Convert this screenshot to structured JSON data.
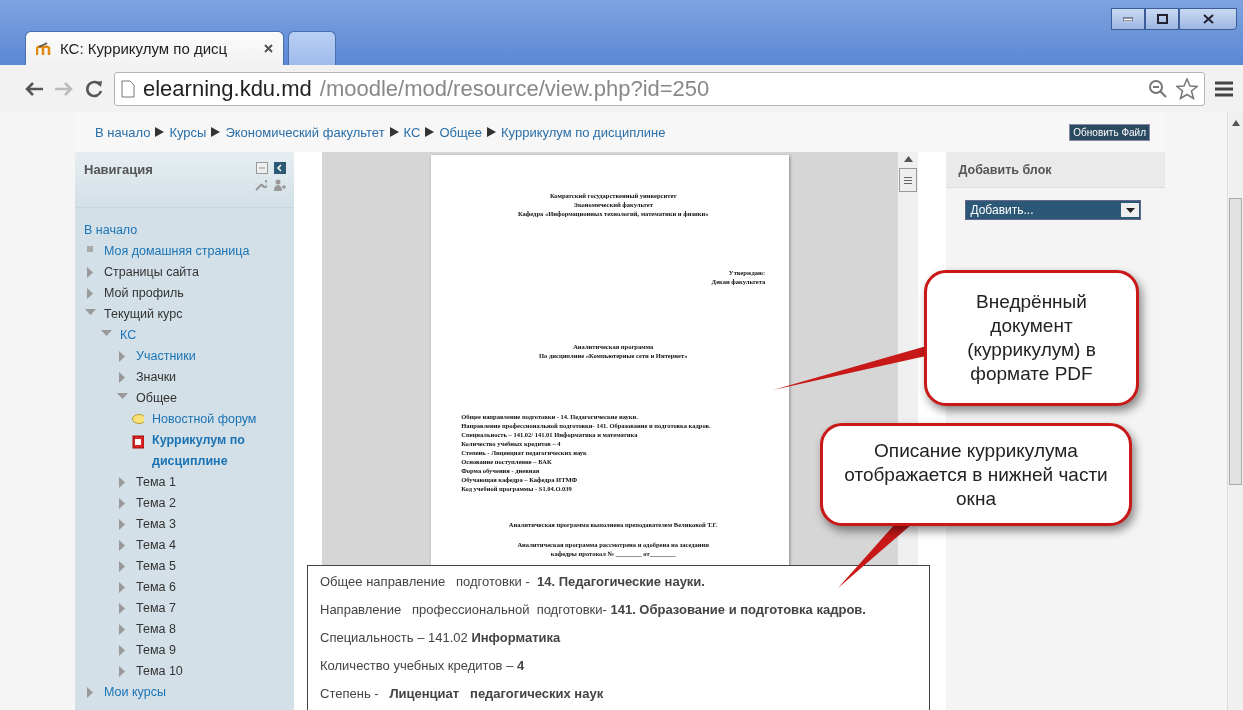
{
  "tabs": [
    {
      "title": "КС: Куррикулум по дисц",
      "selected": true,
      "kind": "page"
    },
    {
      "selected": false,
      "kind": "new"
    }
  ],
  "address": {
    "host": "elearning.kdu.md",
    "path": "/moodle/mod/resource/view.php?id=250"
  },
  "breadcrumb": [
    "В начало",
    "Курсы",
    "Экономический факультет",
    "КС",
    "Общее",
    "Куррикулум по дисциплине"
  ],
  "update_button": "Обновить Файл",
  "navigation": {
    "title": "Навигация",
    "items": [
      {
        "label": "В начало",
        "kind": "root",
        "link": true,
        "selected": false
      },
      {
        "label": "Моя домашняя страница",
        "kind": "leaf",
        "link": true,
        "selected": false
      },
      {
        "label": "Страницы сайта",
        "kind": "branch",
        "expanded": false,
        "link": false,
        "selected": false
      },
      {
        "label": "Мой профиль",
        "kind": "branch",
        "expanded": false,
        "link": false,
        "selected": false
      },
      {
        "label": "Текущий курс",
        "kind": "branch",
        "expanded": true,
        "link": false,
        "selected": false,
        "children": [
          {
            "label": "КС",
            "kind": "branch",
            "expanded": true,
            "link": true,
            "selected": false,
            "children": [
              {
                "label": "Участники",
                "kind": "branch",
                "expanded": false,
                "link": true,
                "selected": false
              },
              {
                "label": "Значки",
                "kind": "branch",
                "expanded": false,
                "link": false,
                "selected": false
              },
              {
                "label": "Общее",
                "kind": "branch",
                "expanded": true,
                "link": false,
                "selected": false,
                "children": [
                  {
                    "label": "Новостной форум",
                    "kind": "forum",
                    "link": true,
                    "selected": false
                  },
                  {
                    "label": "Куррикулум по дисциплине",
                    "kind": "pdf",
                    "link": true,
                    "selected": true
                  }
                ]
              },
              {
                "label": "Тема 1",
                "kind": "branch",
                "expanded": false,
                "link": false,
                "selected": false
              },
              {
                "label": "Тема 2",
                "kind": "branch",
                "expanded": false,
                "link": false,
                "selected": false
              },
              {
                "label": "Тема 3",
                "kind": "branch",
                "expanded": false,
                "link": false,
                "selected": false
              },
              {
                "label": "Тема 4",
                "kind": "branch",
                "expanded": false,
                "link": false,
                "selected": false
              },
              {
                "label": "Тема 5",
                "kind": "branch",
                "expanded": false,
                "link": false,
                "selected": false
              },
              {
                "label": "Тема 6",
                "kind": "branch",
                "expanded": false,
                "link": false,
                "selected": false
              },
              {
                "label": "Тема 7",
                "kind": "branch",
                "expanded": false,
                "link": false,
                "selected": false
              },
              {
                "label": "Тема 8",
                "kind": "branch",
                "expanded": false,
                "link": false,
                "selected": false
              },
              {
                "label": "Тема 9",
                "kind": "branch",
                "expanded": false,
                "link": false,
                "selected": false
              },
              {
                "label": "Тема 10",
                "kind": "branch",
                "expanded": false,
                "link": false,
                "selected": false
              }
            ]
          }
        ]
      },
      {
        "label": "Мои курсы",
        "kind": "branch",
        "expanded": false,
        "link": true,
        "selected": false
      }
    ]
  },
  "pdf_page": [
    {
      "kind": "header",
      "lines": [
        "Комратский государственный университет",
        "Экономический факультет",
        "Кафедра «Информационных технологий, математики и физики»"
      ]
    },
    {
      "kind": "approval",
      "lines": [
        "Утверждаю:",
        "Декан  факультета"
      ]
    },
    {
      "kind": "title",
      "lines": [
        "Аналитическая программа",
        "По   дисциплине  «Компьютерные сети  и Интернет»"
      ]
    },
    {
      "kind": "details",
      "lines": [
        "Общее направление   подготовки -  14. Педагогические науки.",
        "Направление   профессиональной  подготовки- 141. Образование и подготовка кадров.",
        "Специальность – 141.02/ 141.01 Информатика и  математика",
        "Количество учебных кредитов – 4",
        "Степень -   Лиценциат   педагогических наук",
        "Основание    поступление – БАК",
        "Форма   обучения - дневная",
        "Обучающая кафедра – Кафедра  ИТМФ",
        "Код учебной программы   - S1.04.O.039"
      ]
    },
    {
      "kind": "author",
      "lines": [
        "Аналитическая программа  выполнена   преподавателем    Великовой Т.Г."
      ]
    },
    {
      "kind": "review",
      "lines": [
        "Аналитическая программа  рассмотрена    и одобрена    на заседании",
        "кафедры  протокол  № ________ от________"
      ]
    }
  ],
  "add_block": {
    "title": "Добавить блок",
    "select": "Добавить..."
  },
  "description": [
    "Общее направление   подготовки -  **14. Педагогические науки.**",
    "Направление   профессиональной  подготовки- **141. Образование и подготовка кадров.**",
    "Специальность – 141.02 **Информатика**",
    "Количество учебных кредитов – **4**",
    "Степень -   **Лиценциат   педагогических наук**"
  ],
  "callouts": [
    {
      "text": "Внедрённый документ (куррикулум) в формате PDF",
      "kind": "pdf"
    },
    {
      "text": "Описание куррикулума отображается в нижней части окна",
      "kind": "description"
    }
  ]
}
